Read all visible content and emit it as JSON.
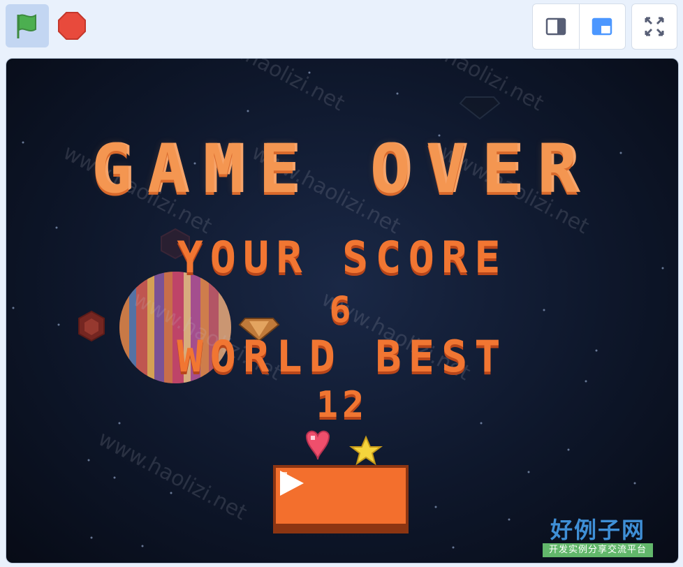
{
  "toolbar": {
    "green_flag_icon": "green-flag-icon",
    "stop_icon": "stop-icon",
    "small_stage_icon": "small-stage-layout-icon",
    "normal_stage_icon": "normal-stage-layout-icon",
    "fullscreen_icon": "fullscreen-icon"
  },
  "game": {
    "title": "GAME OVER",
    "score_label": "YOUR SCORE",
    "score_value": "6",
    "best_label": "WORLD BEST",
    "best_value": "12",
    "play_icon": "play-icon"
  },
  "watermark": {
    "main": "好例子网",
    "sub": "开发实例分享交流平台",
    "diagonal": "www.haolizi.net"
  },
  "colors": {
    "title": "#f49651",
    "text": "#f17632",
    "button": "#f36f2d",
    "flag": "#4caf50",
    "stop": "#e84a3c",
    "layout_active": "#4c97ff"
  }
}
